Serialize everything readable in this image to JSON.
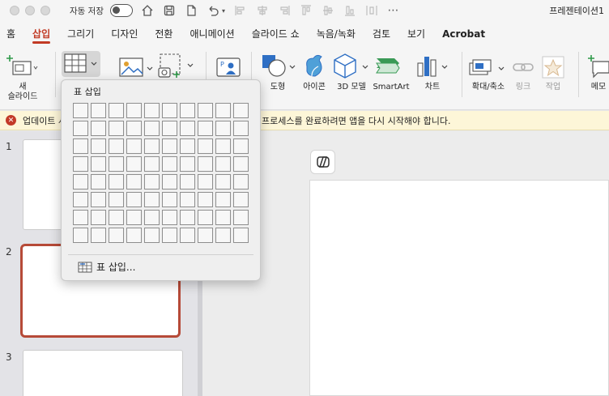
{
  "titlebar": {
    "autosave_label": "자동 저장",
    "document_title": "프레젠테이션1"
  },
  "tabs": [
    {
      "label": "홈",
      "active": false
    },
    {
      "label": "삽입",
      "active": true
    },
    {
      "label": "그리기",
      "active": false
    },
    {
      "label": "디자인",
      "active": false
    },
    {
      "label": "전환",
      "active": false
    },
    {
      "label": "애니메이션",
      "active": false
    },
    {
      "label": "슬라이드 쇼",
      "active": false
    },
    {
      "label": "녹음/녹화",
      "active": false
    },
    {
      "label": "검토",
      "active": false
    },
    {
      "label": "보기",
      "active": false
    },
    {
      "label": "Acrobat",
      "active": false
    }
  ],
  "ribbon": {
    "new_slide": "새\n슬라이드",
    "shapes": "도형",
    "icons": "아이콘",
    "model_3d": "3D 모델",
    "smartart": "SmartArt",
    "chart": "차트",
    "zoom": "확대/축소",
    "link": "링크",
    "action": "작업",
    "comment": "메모"
  },
  "notification": {
    "title": "업데이트 사",
    "message": ". 프로세스를 완료하려면 앱을 다시 시작해야 합니다."
  },
  "thumbnails": {
    "slide_numbers": [
      "1",
      "2",
      "3"
    ]
  },
  "table_dropdown": {
    "title": "표 삽입",
    "grid_columns": 10,
    "grid_rows": 8,
    "insert_item": "표 삽입..."
  },
  "colors": {
    "accent": "#c23a24",
    "selected_slide_border": "#b64a38",
    "notification_bg": "#fdf6d8",
    "error_icon": "#c33a28"
  }
}
